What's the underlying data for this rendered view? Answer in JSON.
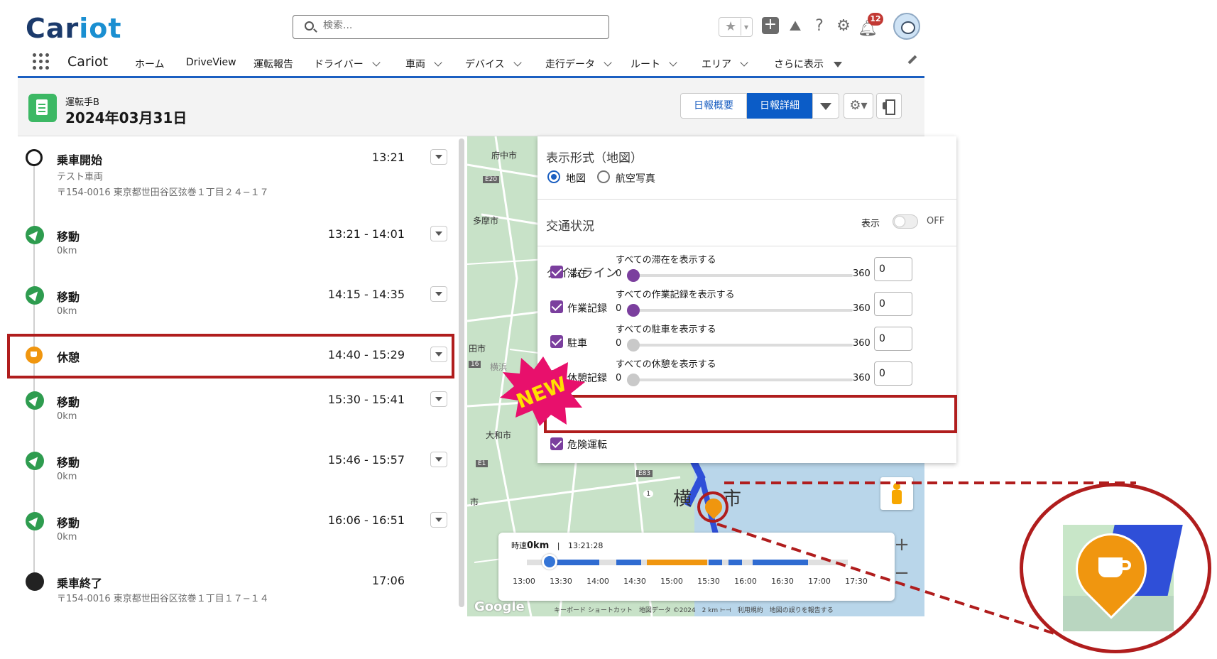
{
  "header": {
    "logo": "Cariot",
    "search_placeholder": "検索...",
    "notification_count": "12"
  },
  "nav": {
    "app_name": "Cariot",
    "items": [
      {
        "label": "ホーム",
        "chevron": false
      },
      {
        "label": "DriveView",
        "chevron": false
      },
      {
        "label": "運転報告",
        "chevron": false
      },
      {
        "label": "ドライバー",
        "chevron": true
      },
      {
        "label": "車両",
        "chevron": true
      },
      {
        "label": "デバイス",
        "chevron": true
      },
      {
        "label": "走行データ",
        "chevron": true
      },
      {
        "label": "ルート",
        "chevron": true
      },
      {
        "label": "エリア",
        "chevron": true
      },
      {
        "label": "さらに表示",
        "chevron": true
      }
    ]
  },
  "record": {
    "subtitle": "運転手B",
    "title": "2024年03月31日",
    "btn_summary": "日報概要",
    "btn_detail": "日報詳細"
  },
  "timeline": [
    {
      "type": "start",
      "title": "乗車開始",
      "time": "13:21",
      "sub1": "テスト車両",
      "sub2": "〒154-0016 東京都世田谷区弦巻１丁目２４−１７"
    },
    {
      "type": "move",
      "title": "移動",
      "time": "13:21 - 14:01",
      "sub1": "0km"
    },
    {
      "type": "move",
      "title": "移動",
      "time": "14:15 - 14:35",
      "sub1": "0km"
    },
    {
      "type": "rest",
      "title": "休憩",
      "time": "14:40 - 15:29"
    },
    {
      "type": "move",
      "title": "移動",
      "time": "15:30 - 15:41",
      "sub1": "0km"
    },
    {
      "type": "move",
      "title": "移動",
      "time": "15:46 - 15:57",
      "sub1": "0km"
    },
    {
      "type": "move",
      "title": "移動",
      "time": "16:06 - 16:51",
      "sub1": "0km"
    },
    {
      "type": "end",
      "title": "乗車終了",
      "time": "17:06",
      "sub1": "〒154-0016 東京都世田谷区弦巻１丁目１７−１４"
    }
  ],
  "map": {
    "labels": [
      "府中市",
      "E20",
      "多摩市",
      "田市",
      "16",
      "横浜",
      "大和市",
      "E1",
      "市",
      "E83",
      "1",
      "横",
      "市"
    ],
    "google": "Google",
    "footer": "キーボード ショートカット　地図データ ©2024　2 km ⊢⊣　利用規約　地図の誤りを報告する",
    "zoom_in": "+",
    "zoom_out": "−"
  },
  "playback": {
    "speed_label": "時速",
    "speed_value": "0km",
    "separator": "|",
    "time": "13:21:28",
    "ticks": [
      "13:00",
      "13:30",
      "14:00",
      "14:30",
      "15:00",
      "15:30",
      "16:00",
      "16:30",
      "17:00",
      "17:30"
    ],
    "segments": [
      {
        "start": "13:21",
        "end": "14:01",
        "color": "#2f6bd1"
      },
      {
        "start": "14:15",
        "end": "14:35",
        "color": "#2f6bd1"
      },
      {
        "start": "14:40",
        "end": "15:29",
        "color": "#f0960f"
      },
      {
        "start": "15:30",
        "end": "15:41",
        "color": "#2f6bd1"
      },
      {
        "start": "15:46",
        "end": "15:57",
        "color": "#2f6bd1"
      },
      {
        "start": "16:06",
        "end": "16:51",
        "color": "#2f6bd1"
      }
    ],
    "current_time": "13:21:28"
  },
  "options": {
    "display_title": "表示形式（地図）",
    "radio_map": "地図",
    "radio_aerial": "航空写真",
    "traffic_title": "交通状況",
    "traffic_show": "表示",
    "traffic_state": "OFF",
    "timeline_title": "タイムライン",
    "slider_min": "0",
    "slider_max": "360",
    "rows": [
      {
        "label": "滞在",
        "checked": true,
        "caption": "すべての滞在を表示する",
        "value": "0",
        "knob_color": "#7b3f9e"
      },
      {
        "label": "作業記録",
        "checked": true,
        "caption": "すべての作業記録を表示する",
        "value": "0",
        "knob_color": "#7b3f9e"
      },
      {
        "label": "駐車",
        "checked": true,
        "caption": "すべての駐車を表示する",
        "value": "0",
        "knob_color": "#c9c9c9"
      },
      {
        "label": "休憩記録",
        "checked": false,
        "caption": "すべての休憩を表示する",
        "value": "0",
        "knob_color": "#c9c9c9"
      }
    ],
    "danger_label": "危険運転"
  },
  "badge": {
    "text": "NEW"
  },
  "colors": {
    "brand_blue": "#0b5cc7",
    "highlight_red": "#b01d1d",
    "rest_orange": "#f0960f",
    "move_green": "#2e9c4f",
    "check_purple": "#7b3f9e"
  }
}
